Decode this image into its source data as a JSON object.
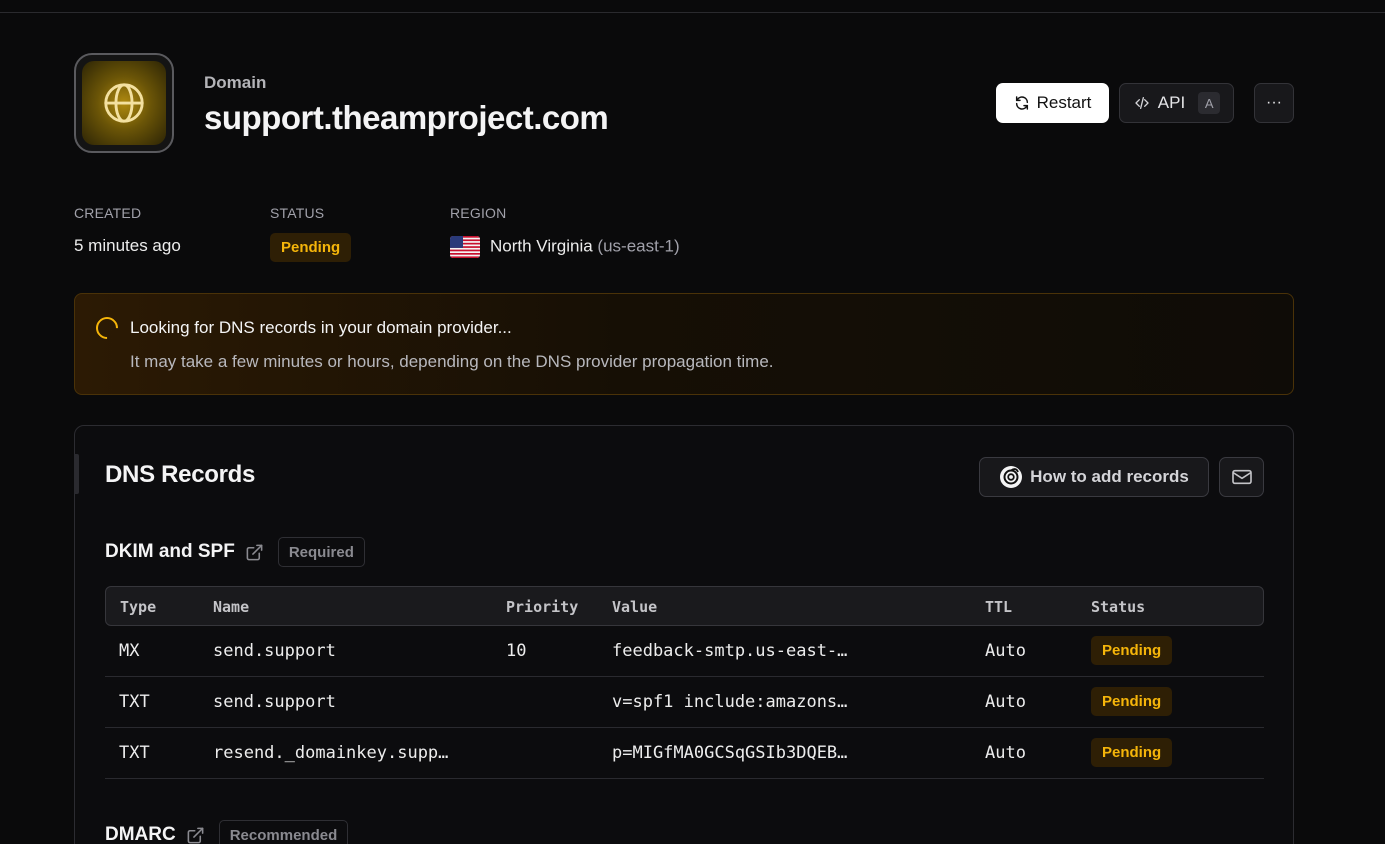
{
  "header": {
    "kicker": "Domain",
    "title": "support.theamproject.com",
    "restart_label": "Restart",
    "api_label": "API",
    "api_shortcut": "A",
    "more_label": "···"
  },
  "meta": {
    "created_label": "CREATED",
    "created_value": "5 minutes ago",
    "status_label": "STATUS",
    "status_value": "Pending",
    "region_label": "REGION",
    "region_name": "North Virginia",
    "region_code": "(us-east-1)"
  },
  "alert": {
    "title": "Looking for DNS records in your domain provider...",
    "text": "It may take a few minutes or hours, depending on the DNS provider propagation time."
  },
  "dns": {
    "title": "DNS Records",
    "howto_label": "How to add records",
    "sections": [
      {
        "title": "DKIM and SPF",
        "tag": "Required"
      },
      {
        "title": "DMARC",
        "tag": "Recommended"
      }
    ],
    "columns": [
      "Type",
      "Name",
      "Priority",
      "Value",
      "TTL",
      "Status"
    ],
    "rows": [
      {
        "type": "MX",
        "name": "send.support",
        "priority": "10",
        "value": "feedback-smtp.us-east-…",
        "ttl": "Auto",
        "status": "Pending"
      },
      {
        "type": "TXT",
        "name": "send.support",
        "priority": "",
        "value": "v=spf1 include:amazons…",
        "ttl": "Auto",
        "status": "Pending"
      },
      {
        "type": "TXT",
        "name": "resend._domainkey.supp…",
        "priority": "",
        "value": "p=MIGfMA0GCSqGSIb3DQEB…",
        "ttl": "Auto",
        "status": "Pending"
      }
    ]
  },
  "colors": {
    "pending": "#f5b50a",
    "pending_bg": "#2e1f05",
    "accent_gold": "#b08a10"
  }
}
